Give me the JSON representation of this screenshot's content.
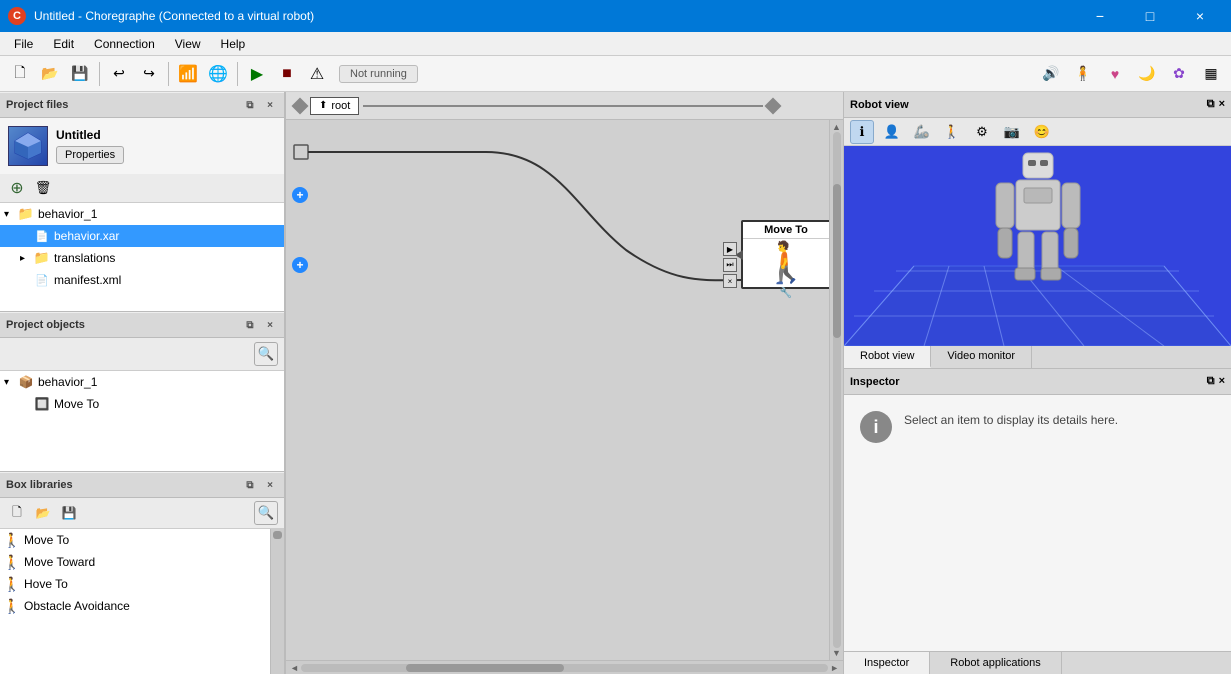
{
  "titlebar": {
    "icon_label": "C",
    "title": "Untitled - Choregraphe (Connected to a virtual robot)",
    "minimize": "−",
    "maximize": "□",
    "close": "×"
  },
  "menubar": {
    "items": [
      "File",
      "Edit",
      "Connection",
      "View",
      "Help"
    ]
  },
  "toolbar": {
    "status": "Not running",
    "buttons": [
      {
        "name": "new",
        "icon": "🗋"
      },
      {
        "name": "open",
        "icon": "📂"
      },
      {
        "name": "save",
        "icon": "💾"
      },
      {
        "name": "undo",
        "icon": "↩"
      },
      {
        "name": "redo",
        "icon": "↪"
      },
      {
        "name": "wifi",
        "icon": "📶"
      },
      {
        "name": "network",
        "icon": "🌐"
      },
      {
        "name": "play",
        "icon": "▶"
      },
      {
        "name": "stop",
        "icon": "■"
      },
      {
        "name": "alert",
        "icon": "⚠"
      }
    ],
    "right_icons": [
      {
        "name": "volume",
        "icon": "🔊"
      },
      {
        "name": "person",
        "icon": "🧍"
      },
      {
        "name": "heart",
        "icon": "♥"
      },
      {
        "name": "moon",
        "icon": "🌙"
      },
      {
        "name": "gear-flower",
        "icon": "✿"
      },
      {
        "name": "bars",
        "icon": "▦"
      }
    ]
  },
  "project_files": {
    "title": "Project files",
    "project_name": "Untitled",
    "properties_btn": "Properties",
    "add_btn": "+",
    "delete_btn": "🗑",
    "tree": [
      {
        "id": "behavior_1",
        "label": "behavior_1",
        "type": "folder",
        "indent": 0,
        "expanded": true
      },
      {
        "id": "behavior_xar",
        "label": "behavior.xar",
        "type": "file",
        "indent": 1,
        "selected": true
      },
      {
        "id": "translations",
        "label": "translations",
        "type": "folder",
        "indent": 1,
        "expanded": false
      },
      {
        "id": "manifest_xml",
        "label": "manifest.xml",
        "type": "file",
        "indent": 1
      }
    ]
  },
  "project_objects": {
    "title": "Project objects",
    "tree": [
      {
        "id": "behavior_1_obj",
        "label": "behavior_1",
        "type": "behavior",
        "indent": 0,
        "expanded": true
      },
      {
        "id": "move_to_obj",
        "label": "Move To",
        "type": "box",
        "indent": 1
      }
    ]
  },
  "box_libraries": {
    "title": "Box libraries",
    "items": [
      {
        "label": "Move To",
        "icon": "🚶"
      },
      {
        "label": "Move Toward",
        "icon": "🚶"
      },
      {
        "label": "Hove To",
        "icon": "🚶"
      },
      {
        "label": "Obstacle Avoidance",
        "icon": "🚶"
      }
    ]
  },
  "canvas": {
    "root_label": "root",
    "flow_node_title": "Move To",
    "flow_node_icon": "🚶"
  },
  "robot_view": {
    "title": "Robot view",
    "tabs": [
      "Robot view",
      "Video monitor"
    ],
    "active_tab": "Robot view",
    "toolbar_icons": [
      {
        "name": "info",
        "icon": "ℹ"
      },
      {
        "name": "person",
        "icon": "👤"
      },
      {
        "name": "joints",
        "icon": "🦾"
      },
      {
        "name": "walk",
        "icon": "🚶"
      },
      {
        "name": "settings",
        "icon": "⚙"
      },
      {
        "name": "monitor",
        "icon": "📷"
      },
      {
        "name": "emotion",
        "icon": "😊"
      }
    ]
  },
  "inspector": {
    "title": "Inspector",
    "message": "Select an item to display its details here.",
    "tabs": [
      "Inspector",
      "Robot applications"
    ],
    "active_tab": "Inspector"
  }
}
